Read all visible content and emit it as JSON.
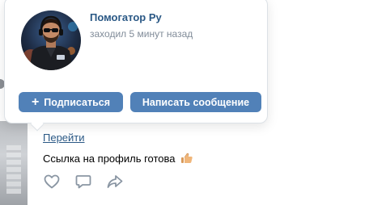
{
  "popup": {
    "name": "Помогатор Ру",
    "status": "заходил 5 минут назад",
    "subscribe_label": "Подписаться",
    "message_label": "Написать сообщение"
  },
  "post": {
    "link_text": "Перейти",
    "text": "Ссылка на профиль готова"
  },
  "icons": {
    "plus": "plus-icon",
    "thumbs_up": "thumbs-up-emoji",
    "like": "heart-icon",
    "comment": "comment-icon",
    "share": "share-icon"
  },
  "colors": {
    "accent": "#5181b8",
    "link": "#2a5885",
    "muted": "#818c99",
    "icon": "#8a96a3"
  }
}
